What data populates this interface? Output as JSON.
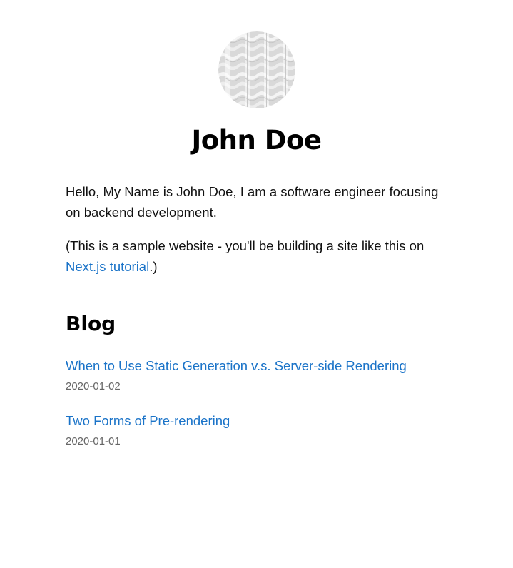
{
  "profile": {
    "name": "John Doe",
    "avatar_icon": "profile-avatar-pattern"
  },
  "intro": {
    "bio": "Hello, My Name is John Doe, I am a software engineer focusing on backend development.",
    "note_prefix": "(This is a sample website - you'll be building a site like this on ",
    "note_link": "Next.js tutorial",
    "note_suffix": ".)"
  },
  "blog": {
    "title": "Blog",
    "posts": [
      {
        "title": "When to Use Static Generation v.s. Server-side Rendering",
        "date": "2020-01-02"
      },
      {
        "title": "Two Forms of Pre-rendering",
        "date": "2020-01-01"
      }
    ]
  },
  "colors": {
    "link": "#1a73c8",
    "date": "#666666",
    "text": "#111111"
  }
}
